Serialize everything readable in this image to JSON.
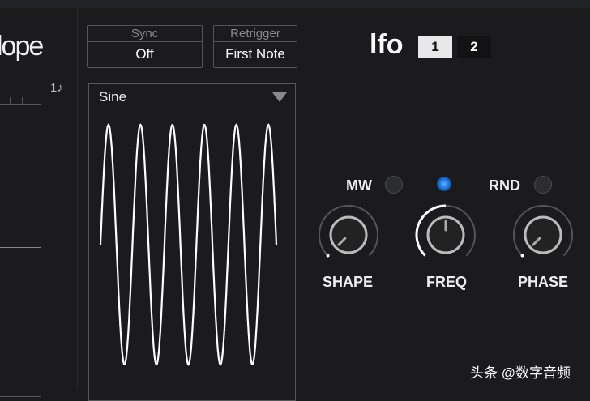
{
  "envelope": {
    "title": "lope",
    "value": "1♪"
  },
  "sync": {
    "label": "Sync",
    "value": "Off"
  },
  "retrigger": {
    "label": "Retrigger",
    "value": "First Note"
  },
  "waveform": {
    "selected": "Sine",
    "cycles": 5.5
  },
  "lfo": {
    "title": "lfo",
    "tabs": [
      "1",
      "2"
    ],
    "active_tab": "1"
  },
  "mw": {
    "label": "MW",
    "on": false
  },
  "freq_led": {
    "on": true
  },
  "rnd": {
    "label": "RND",
    "on": false
  },
  "knobs": [
    {
      "label": "SHAPE",
      "value": 0.0
    },
    {
      "label": "FREQ",
      "value": 0.5
    },
    {
      "label": "PHASE",
      "value": 0.0
    }
  ],
  "watermark": "头条 @数字音频",
  "colors": {
    "led_on": "#1e7fe8",
    "accent": "#ffffff"
  }
}
